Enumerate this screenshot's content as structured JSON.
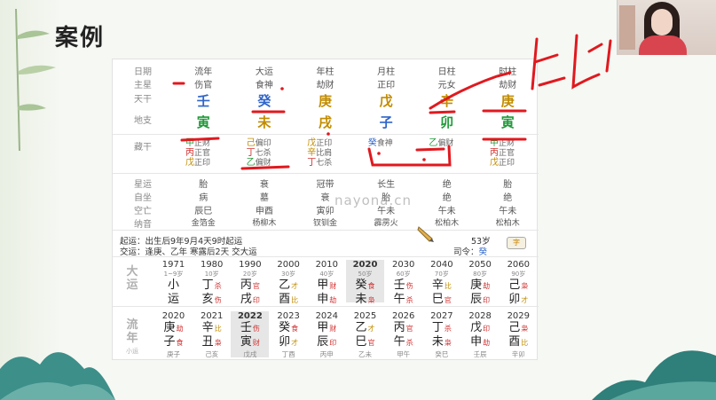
{
  "title": "案例",
  "watermark": "nayona.cn",
  "colors": {
    "red": "#d23030",
    "blue": "#2f65c9",
    "yellow": "#c28c00",
    "green": "#219a3a"
  },
  "pillars": {
    "header": [
      "日期",
      "流年",
      "大运",
      "年柱",
      "月柱",
      "日柱",
      "时柱"
    ],
    "zhuxing": [
      "主星",
      "伤官",
      "食神",
      "劫财",
      "正印",
      "元女",
      "劫财"
    ],
    "tiangan": [
      "天干",
      "壬",
      "癸",
      "庚",
      "戊",
      "辛",
      "庚"
    ],
    "dizhi": [
      "地支",
      "寅",
      "未",
      "戌",
      "子",
      "卯",
      "寅"
    ]
  },
  "canggan_label": "藏干",
  "canggan": [
    [
      [
        "甲",
        "正财"
      ],
      [
        "丙",
        "正官"
      ],
      [
        "戊",
        "正印"
      ]
    ],
    [
      [
        "己",
        "偏印"
      ],
      [
        "丁",
        "七杀"
      ],
      [
        "乙",
        "偏财"
      ]
    ],
    [
      [
        "戊",
        "正印"
      ],
      [
        "辛",
        "比肩"
      ],
      [
        "丁",
        "七杀"
      ]
    ],
    [
      [
        "癸",
        "食神"
      ]
    ],
    [
      [
        "乙",
        "偏财"
      ]
    ],
    [
      [
        "甲",
        "正财"
      ],
      [
        "丙",
        "正官"
      ],
      [
        "戊",
        "正印"
      ]
    ]
  ],
  "lower": {
    "labels": [
      "星运",
      "自坐",
      "空亡",
      "纳音"
    ],
    "cols": [
      [
        "胎",
        "病",
        "辰巳",
        "金箔金"
      ],
      [
        "衰",
        "墓",
        "申酉",
        "杨柳木"
      ],
      [
        "冠带",
        "衰",
        "寅卯",
        "钗钏金"
      ],
      [
        "长生",
        "胎",
        "午未",
        "霹雳火"
      ],
      [
        "绝",
        "绝",
        "午未",
        "松柏木"
      ],
      [
        "胎",
        "绝",
        "午未",
        "松柏木"
      ]
    ]
  },
  "qiyun": {
    "line1_label": "起运：",
    "line1": "出生后9年9月4天9时起运",
    "line1_right": "53岁",
    "line2_label": "交运：",
    "line2": "逢庚、乙年 寒露后2天 交大运",
    "line2_right_label": "司令：",
    "line2_right": "癸",
    "button": "字"
  },
  "dayun_label": [
    "大",
    "运"
  ],
  "dayun": [
    {
      "year": "1971",
      "age": "1~9岁",
      "gan": "小",
      "zhi": "运"
    },
    {
      "year": "1980",
      "age": "10岁",
      "gan": "丁",
      "gs": "杀",
      "zhi": "亥",
      "zs": "伤"
    },
    {
      "year": "1990",
      "age": "20岁",
      "gan": "丙",
      "gs": "官",
      "zhi": "戌",
      "zs": "印"
    },
    {
      "year": "2000",
      "age": "30岁",
      "gan": "乙",
      "gs": "才",
      "zhi": "酉",
      "zs": "比"
    },
    {
      "year": "2010",
      "age": "40岁",
      "gan": "甲",
      "gs": "财",
      "zhi": "申",
      "zs": "劫"
    },
    {
      "year": "2020",
      "age": "50岁",
      "gan": "癸",
      "gs": "食",
      "zhi": "未",
      "zs": "枭",
      "active": true
    },
    {
      "year": "2030",
      "age": "60岁",
      "gan": "壬",
      "gs": "伤",
      "zhi": "午",
      "zs": "杀"
    },
    {
      "year": "2040",
      "age": "70岁",
      "gan": "辛",
      "gs": "比",
      "zhi": "巳",
      "zs": "官"
    },
    {
      "year": "2050",
      "age": "80岁",
      "gan": "庚",
      "gs": "劫",
      "zhi": "辰",
      "zs": "印"
    },
    {
      "year": "2060",
      "age": "90岁",
      "gan": "己",
      "gs": "枭",
      "zhi": "卯",
      "zs": "才"
    }
  ],
  "liunian_label": [
    "流",
    "年",
    "小运"
  ],
  "liunian": [
    {
      "year": "2020",
      "gan": "庚",
      "gs": "劫",
      "zhi": "子",
      "zs": "食",
      "sub": "庚子"
    },
    {
      "year": "2021",
      "gan": "辛",
      "gs": "比",
      "zhi": "丑",
      "zs": "枭",
      "sub": "己亥"
    },
    {
      "year": "2022",
      "gan": "壬",
      "gs": "伤",
      "zhi": "寅",
      "zs": "财",
      "sub": "戊戌",
      "active": true
    },
    {
      "year": "2023",
      "gan": "癸",
      "gs": "食",
      "zhi": "卯",
      "zs": "才",
      "sub": "丁酉"
    },
    {
      "year": "2024",
      "gan": "甲",
      "gs": "财",
      "zhi": "辰",
      "zs": "印",
      "sub": "丙申"
    },
    {
      "year": "2025",
      "gan": "乙",
      "gs": "才",
      "zhi": "巳",
      "zs": "官",
      "sub": "乙未"
    },
    {
      "year": "2026",
      "gan": "丙",
      "gs": "官",
      "zhi": "午",
      "zs": "杀",
      "sub": "甲午"
    },
    {
      "year": "2027",
      "gan": "丁",
      "gs": "杀",
      "zhi": "未",
      "zs": "枭",
      "sub": "癸巳"
    },
    {
      "year": "2028",
      "gan": "戊",
      "gs": "印",
      "zhi": "申",
      "zs": "劫",
      "sub": "壬辰"
    },
    {
      "year": "2029",
      "gan": "己",
      "gs": "枭",
      "zhi": "酉",
      "zs": "比",
      "sub": "辛卯"
    }
  ],
  "handwriting": "比肩"
}
